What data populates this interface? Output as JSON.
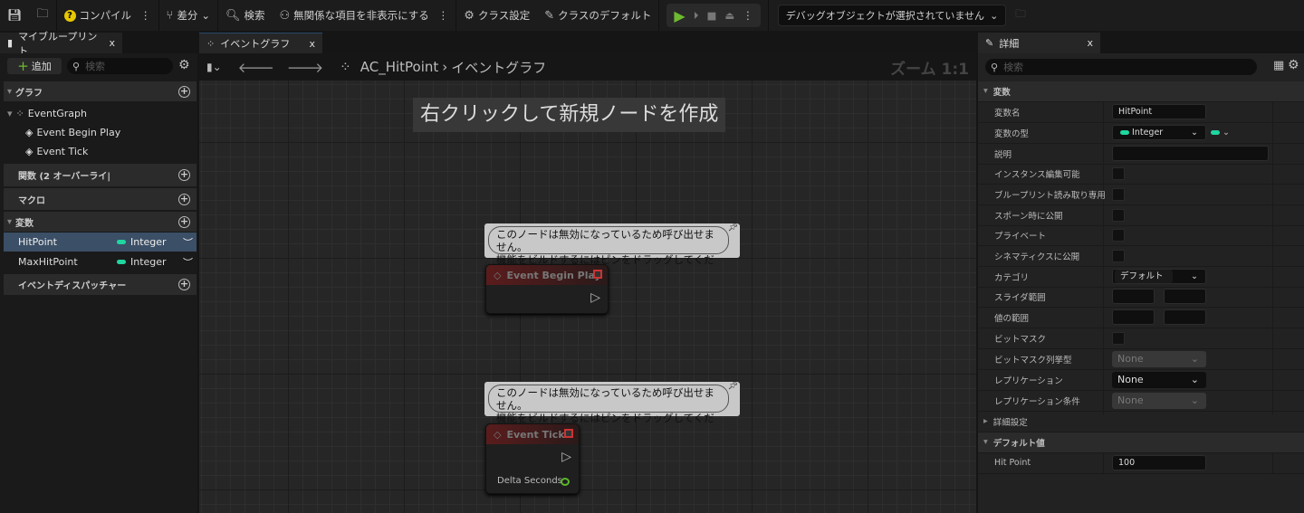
{
  "toolbar": {
    "compile": "コンパイル",
    "diff": "差分",
    "search": "検索",
    "hide_unrelated": "無関係な項目を非表示にする",
    "class_settings": "クラス設定",
    "class_defaults": "クラスのデフォルト",
    "debug_object": "デバッグオブジェクトが選択されていません"
  },
  "tabs": {
    "my_blueprint": "マイブループリント",
    "event_graph": "イベントグラフ",
    "details": "詳細",
    "close": "x"
  },
  "left": {
    "add": "追加",
    "search_placeholder": "検索",
    "graph_header": "グラフ",
    "event_graph": "EventGraph",
    "events": [
      "Event Begin Play",
      "Event Tick"
    ],
    "functions_header": "関数 (2 オーバーライ|",
    "macros_header": "マクロ",
    "variables_header": "変数",
    "variables": [
      {
        "name": "HitPoint",
        "type": "Integer"
      },
      {
        "name": "MaxHitPoint",
        "type": "Integer"
      }
    ],
    "dispatchers_header": "イベントディスパッチャー"
  },
  "graph": {
    "blueprint": "AC_HitPoint",
    "breadcrumb": "イベントグラフ",
    "zoom": "ズーム 1:1",
    "hint": "右クリックして新規ノードを作成",
    "comment_line1": "このノードは無効になっているため呼び出せません。",
    "comment_line2": "機能をビルドするにはピンをドラッグしてください。",
    "nodes": [
      {
        "title": "Event Begin Play"
      },
      {
        "title": "Event Tick",
        "pin": "Delta Seconds"
      }
    ]
  },
  "details": {
    "search_placeholder": "検索",
    "section_variable": "変数",
    "rows": {
      "var_name": "変数名",
      "var_name_value": "HitPoint",
      "var_type": "変数の型",
      "var_type_value": "Integer",
      "description": "説明",
      "instance_editable": "インスタンス編集可能",
      "bp_readonly": "ブループリント読み取り専用",
      "expose_spawn": "スポーン時に公開",
      "private": "プライベート",
      "expose_cinematics": "シネマティクスに公開",
      "category": "カテゴリ",
      "category_value": "デフォルト",
      "slider_range": "スライダ範囲",
      "value_range": "値の範囲",
      "bitmask": "ビットマスク",
      "bitmask_enum": "ビットマスク列挙型",
      "bitmask_enum_value": "None",
      "replication": "レプリケーション",
      "replication_value": "None",
      "replication_cond": "レプリケーション条件",
      "replication_cond_value": "None"
    },
    "advanced": "詳細設定",
    "section_default": "デフォルト値",
    "default_label": "Hit Point",
    "default_value": "100"
  },
  "colors": {
    "integer_pin": "#1fd6a0",
    "play": "#6dbb2f",
    "selected_row": "#3b4f66"
  }
}
